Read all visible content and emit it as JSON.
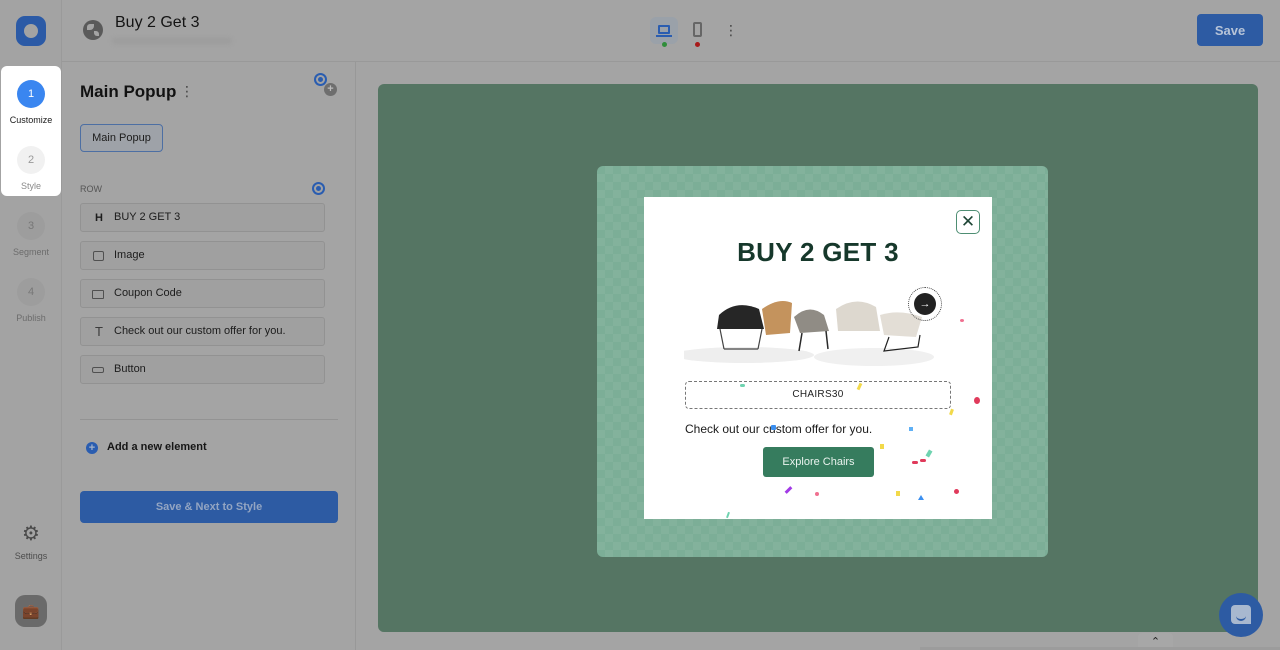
{
  "app": {
    "title": "Buy 2 Get 3"
  },
  "rail": {
    "steps": [
      {
        "number": "1",
        "label": "Customize",
        "state": "active"
      },
      {
        "number": "2",
        "label": "Style",
        "state": "inactive"
      },
      {
        "number": "3",
        "label": "Segment",
        "state": "inactive"
      },
      {
        "number": "4",
        "label": "Publish",
        "state": "inactive"
      }
    ],
    "settings_label": "Settings"
  },
  "topbar": {
    "devices": [
      {
        "name": "desktop",
        "selected": true,
        "status_color": "#2f8d3a"
      },
      {
        "name": "mobile",
        "selected": false,
        "status_color": "#a81a1a"
      }
    ],
    "more_icon": "⋮",
    "save_label": "Save"
  },
  "panel": {
    "title": "Main Popup",
    "more_icon": "⋮",
    "chip_label": "Main Popup",
    "row_label": "ROW",
    "elements": [
      {
        "icon": "H",
        "type": "heading",
        "label": "BUY 2 GET 3"
      },
      {
        "icon": "image-icon",
        "type": "image",
        "label": "Image"
      },
      {
        "icon": "coupon-icon",
        "type": "coupon",
        "label": "Coupon Code"
      },
      {
        "icon": "T",
        "type": "text",
        "label": "Check out our custom offer for you."
      },
      {
        "icon": "button-icon",
        "type": "button",
        "label": "Button"
      }
    ],
    "add_label": "Add a new element",
    "add_icon": "+",
    "next_label": "Save & Next to Style"
  },
  "popup": {
    "close_icon": "✕",
    "heading": "BUY 2 GET 3",
    "coupon_code": "CHAIRS30",
    "text": "Check out our custom offer for you.",
    "cta_label": "Explore Chairs",
    "badge_icon": "→",
    "colors": {
      "heading": "#16382b",
      "cta": "#367c5e",
      "overlay": "#7cae97"
    }
  },
  "widgets": {
    "collapse_icon": "⌃"
  },
  "colors": {
    "accent": "#2d5ba3",
    "active_step": "#3a86f0",
    "canvas_bg": "#557563"
  }
}
